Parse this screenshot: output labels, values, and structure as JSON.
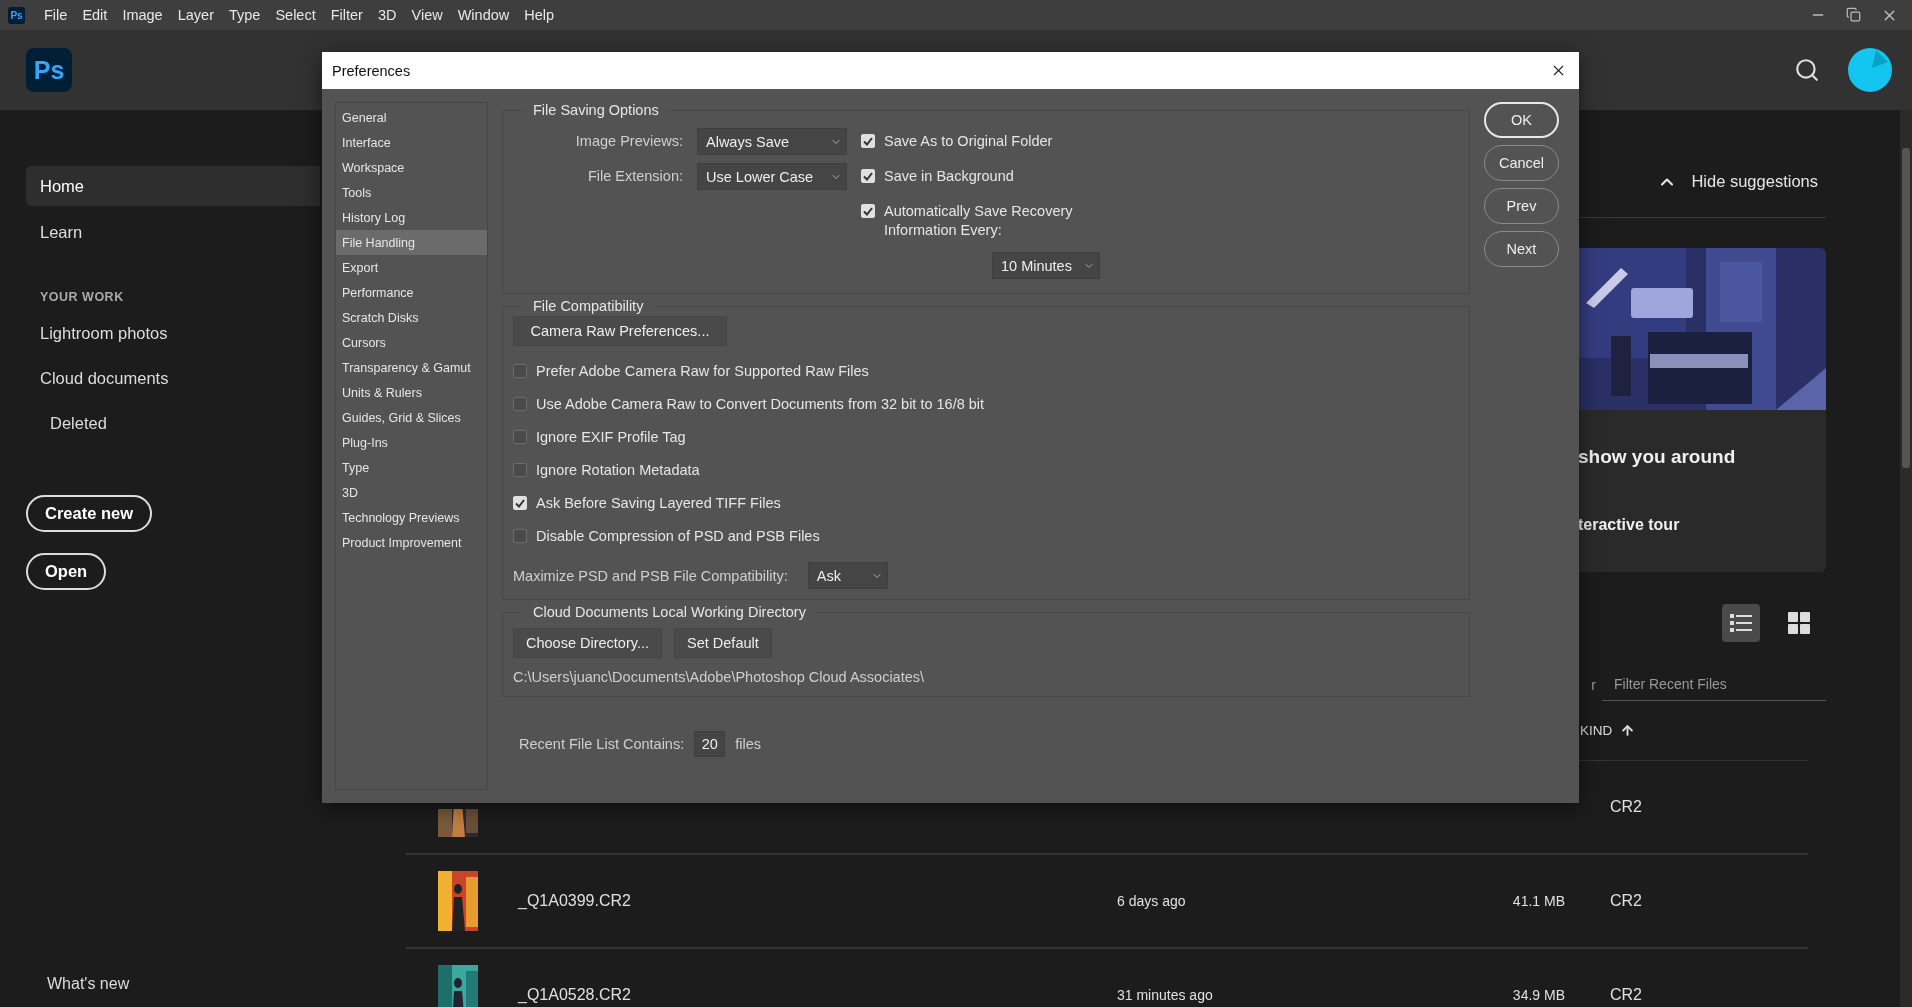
{
  "menubar": {
    "items": [
      "File",
      "Edit",
      "Image",
      "Layer",
      "Type",
      "Select",
      "Filter",
      "3D",
      "View",
      "Window",
      "Help"
    ]
  },
  "app_icon": "Ps",
  "app_logo": "Ps",
  "home_sidebar": {
    "nav": [
      {
        "label": "Home",
        "selected": true
      },
      {
        "label": "Learn",
        "selected": false
      }
    ],
    "section_title": "YOUR WORK",
    "work_items": [
      {
        "label": "Lightroom photos"
      },
      {
        "label": "Cloud documents",
        "children": [
          {
            "label": "Deleted"
          }
        ]
      }
    ],
    "buttons": [
      "Create new",
      "Open"
    ],
    "footer_link": "What's new"
  },
  "suggestions": {
    "toggle": "Hide suggestions",
    "tour_title": "show you around",
    "tour_link": "teractive tour"
  },
  "files": {
    "views": [
      {
        "kind": "list",
        "selected": true
      },
      {
        "kind": "grid",
        "selected": false
      }
    ],
    "filter_label": "r",
    "filter_placeholder": "Filter Recent Files",
    "kind_header": "KIND",
    "rows": [
      {
        "file_type": "CR2"
      },
      {
        "name": "_Q1A0399.CR2",
        "modified": "6 days ago",
        "size": "41.1 MB",
        "file_type": "CR2"
      },
      {
        "name": "_Q1A0528.CR2",
        "modified": "31 minutes ago",
        "size": "34.9 MB",
        "file_type": "CR2"
      }
    ]
  },
  "dialog": {
    "title": "Preferences",
    "categories": [
      {
        "label": "General",
        "selected": false
      },
      {
        "label": "Interface",
        "selected": false
      },
      {
        "label": "Workspace",
        "selected": false
      },
      {
        "label": "Tools",
        "selected": false
      },
      {
        "label": "History Log",
        "selected": false
      },
      {
        "label": "File Handling",
        "selected": true
      },
      {
        "label": "Export",
        "selected": false
      },
      {
        "label": "Performance",
        "selected": false
      },
      {
        "label": "Scratch Disks",
        "selected": false
      },
      {
        "label": "Cursors",
        "selected": false
      },
      {
        "label": "Transparency & Gamut",
        "selected": false
      },
      {
        "label": "Units & Rulers",
        "selected": false
      },
      {
        "label": "Guides, Grid & Slices",
        "selected": false
      },
      {
        "label": "Plug-Ins",
        "selected": false
      },
      {
        "label": "Type",
        "selected": false
      },
      {
        "label": "3D",
        "selected": false
      },
      {
        "label": "Technology Previews",
        "selected": false
      },
      {
        "label": "Product Improvement",
        "selected": false
      }
    ],
    "file_saving": {
      "title": "File Saving Options",
      "fields": [
        {
          "label": "Image Previews:",
          "value": "Always Save"
        },
        {
          "label": "File Extension:",
          "value": "Use Lower Case"
        }
      ],
      "checks": [
        {
          "label": "Save As to Original Folder",
          "checked": true
        },
        {
          "label": "Save in Background",
          "checked": true
        },
        {
          "label": "Automatically Save Recovery Information Every:",
          "checked": true
        }
      ],
      "interval": "10 Minutes"
    },
    "file_compat": {
      "title": "File Compatibility",
      "button": "Camera Raw Preferences...",
      "checks": [
        {
          "label": "Prefer Adobe Camera Raw for Supported Raw Files",
          "checked": false
        },
        {
          "label": "Use Adobe Camera Raw to Convert Documents from 32 bit to 16/8 bit",
          "checked": false
        },
        {
          "label": "Ignore EXIF Profile Tag",
          "checked": false
        },
        {
          "label": "Ignore Rotation Metadata",
          "checked": false
        },
        {
          "label": "Ask Before Saving Layered TIFF Files",
          "checked": true
        },
        {
          "label": "Disable Compression of PSD and PSB Files",
          "checked": false
        }
      ],
      "maximize": {
        "label": "Maximize PSD and PSB File Compatibility:",
        "value": "Ask"
      }
    },
    "cloud_dir": {
      "title": "Cloud Documents Local Working Directory",
      "buttons": [
        "Choose Directory...",
        "Set Default"
      ],
      "path": "C:\\Users\\juanc\\Documents\\Adobe\\Photoshop Cloud Associates\\"
    },
    "recent": {
      "label": "Recent File List Contains:",
      "value": "20",
      "unit": "files"
    },
    "actions": [
      {
        "label": "OK",
        "default": true
      },
      {
        "label": "Cancel",
        "default": false
      },
      {
        "label": "Prev",
        "default": false
      },
      {
        "label": "Next",
        "default": false
      }
    ]
  }
}
